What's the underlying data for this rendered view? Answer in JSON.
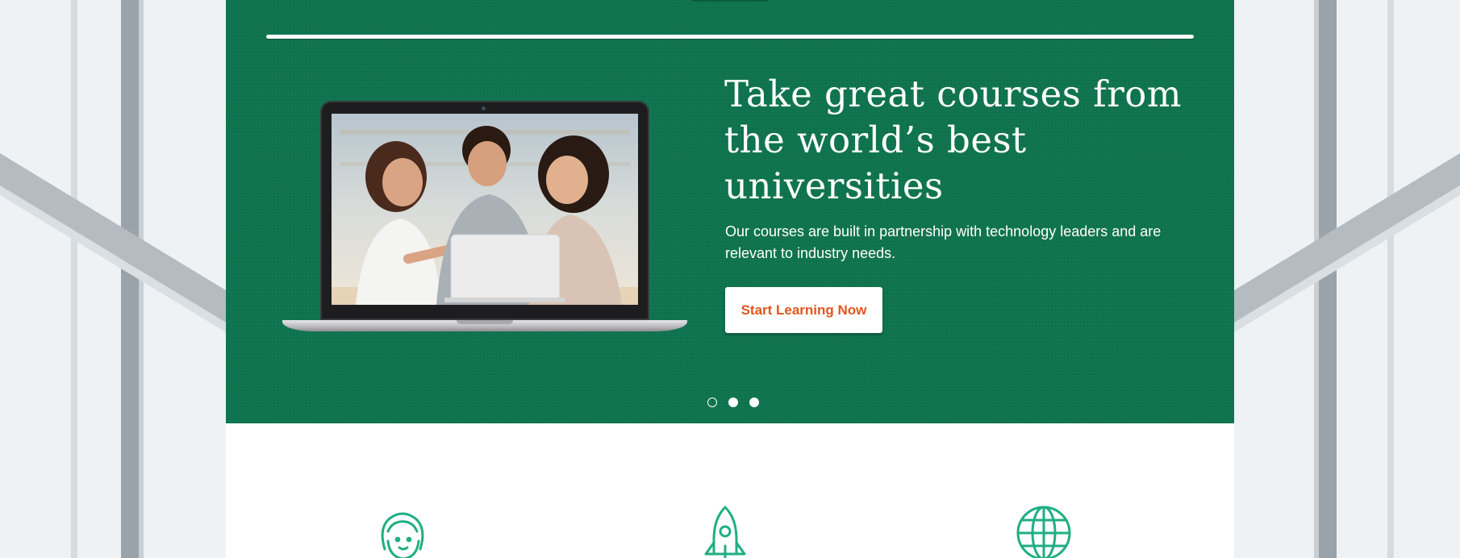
{
  "hero": {
    "title": "Take great courses from the world’s best universities",
    "subtitle": "Our courses are built in partnership with technology leaders and are relevant to industry needs.",
    "cta_label": "Start Learning Now",
    "slides": [
      {
        "active": true
      },
      {
        "active": false
      },
      {
        "active": false
      }
    ]
  },
  "laptop": {
    "screen_image": "students-around-laptop-photo"
  },
  "features": {
    "icons": [
      "student-girl-icon",
      "rocket-icon",
      "globe-icon"
    ]
  },
  "colors": {
    "hero_background": "#0f7350",
    "cta_text": "#e0561c",
    "feature_icon": "#1fae82",
    "page_background": "#ffffff"
  }
}
